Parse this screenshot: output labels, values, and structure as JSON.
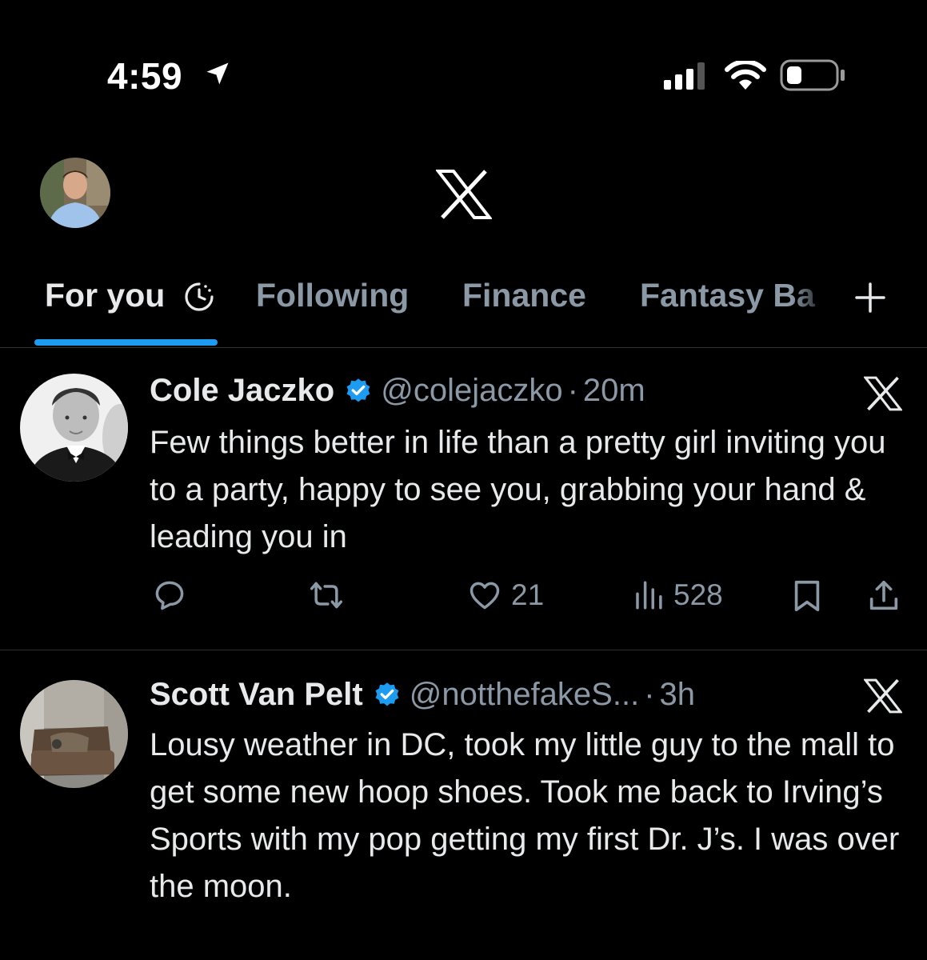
{
  "status_bar": {
    "time": "4:59",
    "icons": [
      "location-arrow-icon",
      "cellular-signal-icon",
      "wifi-icon",
      "battery-icon"
    ]
  },
  "header": {
    "logo": "X",
    "profile_avatar": "avatar"
  },
  "tabs": [
    {
      "label": "For you",
      "active": true
    },
    {
      "label": "Following",
      "active": false
    },
    {
      "label": "Finance",
      "active": false
    },
    {
      "label": "Fantasy Ba",
      "active": false
    }
  ],
  "posts": [
    {
      "name": "Cole Jaczko",
      "verified": true,
      "handle": "@colejaczko",
      "separator": "·",
      "time": "20m",
      "text": "Few things better in life than a pretty girl inviting you to a party, happy to see you, grabbing your hand & leading you in",
      "likes": "21",
      "views": "528"
    },
    {
      "name": "Scott Van Pelt",
      "verified": true,
      "handle": "@notthefakeS...",
      "separator": "·",
      "time": "3h",
      "text": "Lousy weather in DC, took my little guy to the mall to get some new hoop shoes. Took me back to Irving’s Sports with my pop getting my first Dr. J’s. I was over the moon."
    }
  ],
  "colors": {
    "background": "#000000",
    "text": "#e7e9ea",
    "muted": "#8b98a5",
    "accent": "#1d9bf0",
    "divider": "#2f3336"
  }
}
